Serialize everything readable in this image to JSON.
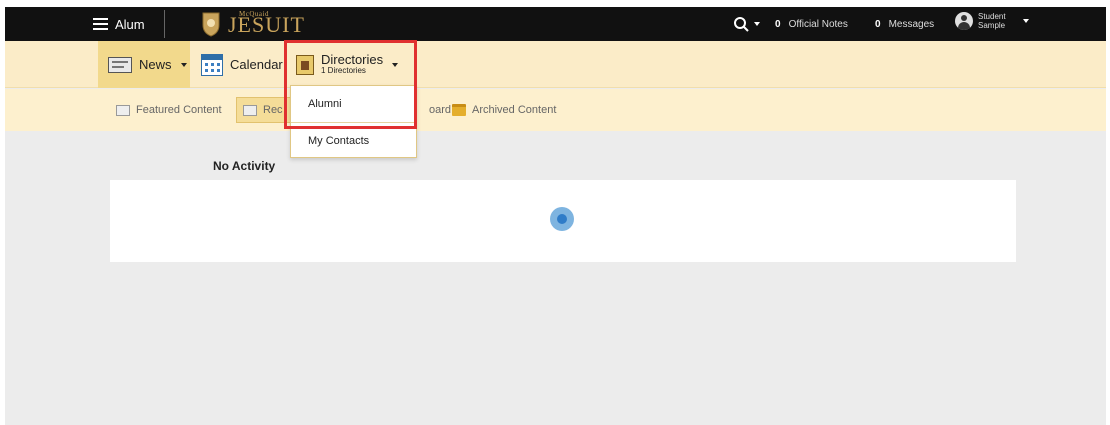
{
  "topbar": {
    "menu_label": "Alum",
    "logo_small": "McQuaid",
    "logo_big": "JESUIT",
    "official_notes_count": "0",
    "official_notes_label": "Official Notes",
    "messages_count": "0",
    "messages_label": "Messages",
    "user_first": "Student",
    "user_last": "Sample"
  },
  "nav": {
    "news": "News",
    "calendar": "Calendar",
    "directories": "Directories",
    "directories_sub": "1 Directories"
  },
  "subnav": {
    "featured": "Featured Content",
    "recent_visible": "Rec",
    "board_visible": "oard",
    "archived": "Archived Content"
  },
  "dropdown": {
    "items": [
      "Alumni",
      "My Contacts"
    ]
  },
  "main": {
    "no_activity": "No Activity"
  },
  "colors": {
    "topbar": "#111111",
    "nav_bg": "#fbecc8",
    "highlight_box": "#e03030",
    "spinner": "#2f7cc8"
  }
}
